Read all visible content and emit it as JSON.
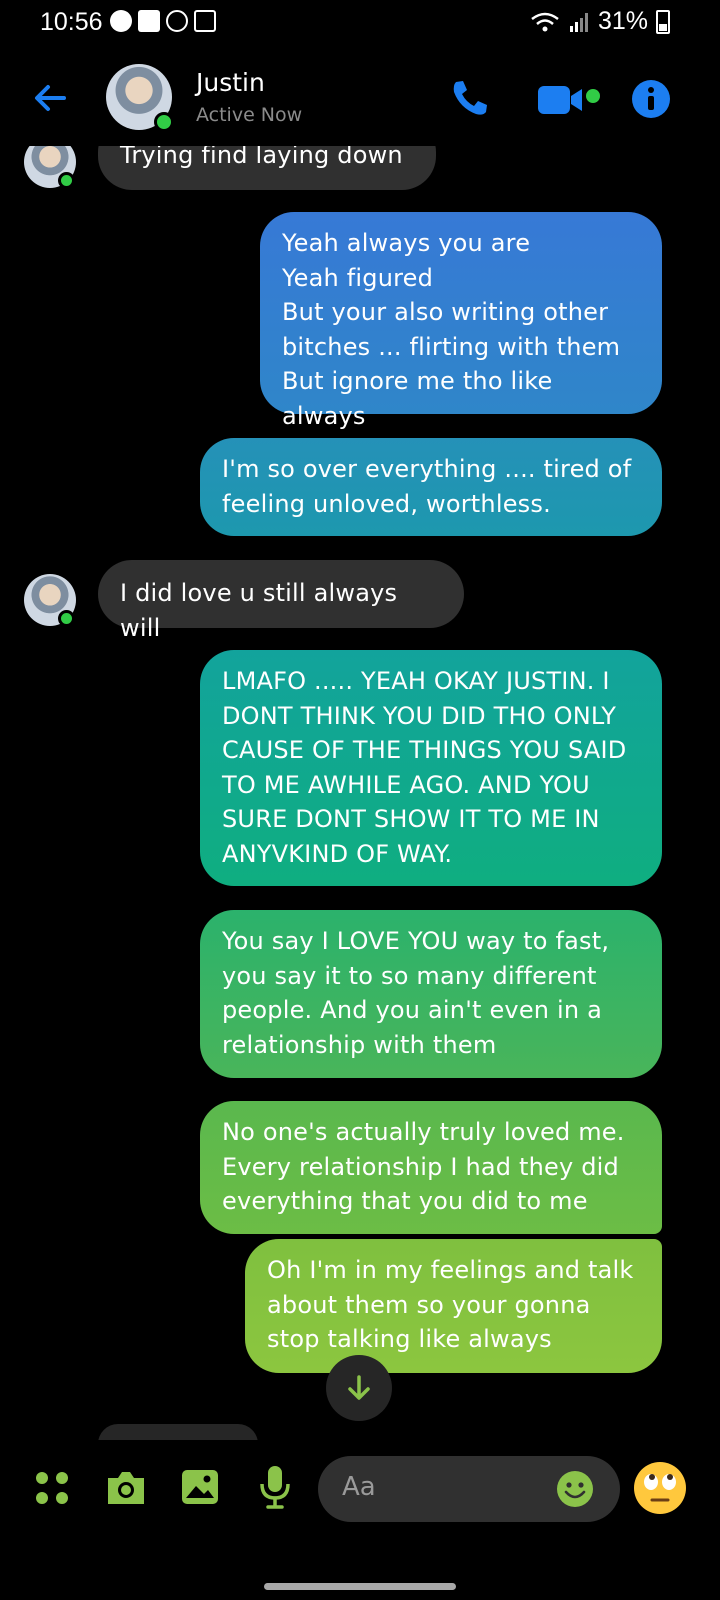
{
  "status_bar": {
    "time": "10:56",
    "battery": "31%"
  },
  "header": {
    "contact_name": "Justin",
    "contact_status": "Active Now"
  },
  "messages": [
    {
      "dir": "in",
      "text": "Trying find laying  down"
    },
    {
      "dir": "out",
      "text": "Yeah always you are\nYeah figured\nBut your also writing other bitches ... flirting with them\nBut ignore me tho like always"
    },
    {
      "dir": "out",
      "text": "I'm so over everything .... tired of feeling unloved, worthless."
    },
    {
      "dir": "in",
      "text": "I did love u still always  will"
    },
    {
      "dir": "out",
      "text": "LMAFO ..... YEAH OKAY JUSTIN. I DONT THINK YOU DID THO ONLY CAUSE OF THE THINGS YOU SAID TO ME AWHILE AGO. AND YOU SURE DONT SHOW IT TO ME IN ANYVKIND OF WAY."
    },
    {
      "dir": "out",
      "text": "You say I LOVE YOU way to fast, you say it to so many different people. And you ain't even in a relationship with them"
    },
    {
      "dir": "out",
      "text": "No one's actually  truly loved me. Every relationship I had they did everything that you did to me"
    },
    {
      "dir": "out",
      "text": "Oh I'm in my feelings and talk about them so your gonna stop talking like always"
    }
  ],
  "composer": {
    "placeholder": "Aa"
  },
  "colors": {
    "accent_blue": "#1c7ef1",
    "incoming_bubble": "#303030",
    "gradient_top": "#3b7de0",
    "gradient_bottom": "#8cc63f",
    "composer_icon": "#8bc34a"
  },
  "icons": [
    "back-arrow",
    "phone",
    "video-camera",
    "info",
    "scroll-down-arrow",
    "apps-grid",
    "camera",
    "gallery",
    "microphone",
    "emoji",
    "eye-roll-emoji"
  ]
}
